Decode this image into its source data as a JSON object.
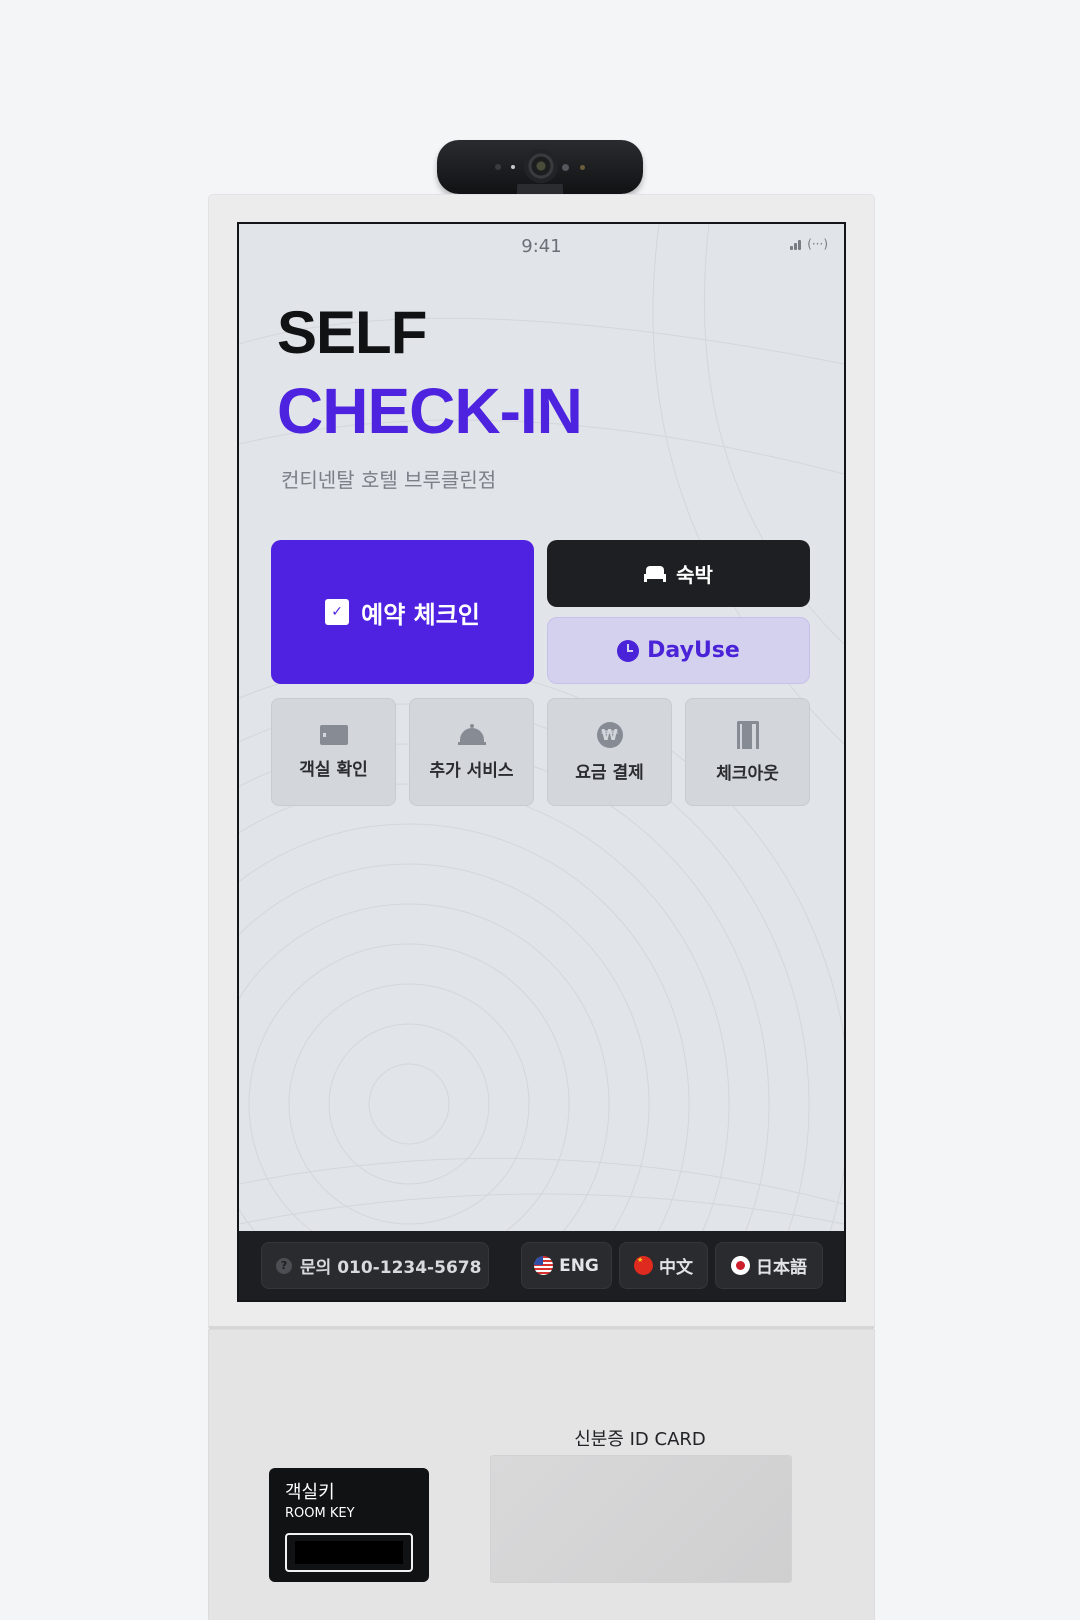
{
  "status_bar": {
    "time": "9:41",
    "signal_icon": "signal-icon",
    "wifi_icon": "wifi-icon"
  },
  "header": {
    "title_line1": "SELF",
    "title_line2": "CHECK-IN",
    "hotel_name": "컨티넨탈 호텔 브루클린점"
  },
  "colors": {
    "accent": "#4f22e2",
    "dark": "#1e1f22",
    "dayuse_bg": "#d4d1ef",
    "screen_bg": "#e1e4e8"
  },
  "main_actions": {
    "reservation_checkin": {
      "label": "예약 체크인",
      "icon": "clipboard-check-icon"
    },
    "stay": {
      "label": "숙박",
      "icon": "bed-icon"
    },
    "dayuse": {
      "label": "DayUse",
      "icon": "clock-icon"
    }
  },
  "sub_actions": [
    {
      "label": "객실 확인",
      "icon": "key-card-icon"
    },
    {
      "label": "추가 서비스",
      "icon": "service-bell-icon"
    },
    {
      "label": "요금 결제",
      "icon": "won-icon"
    },
    {
      "label": "체크아웃",
      "icon": "door-icon"
    }
  ],
  "footer": {
    "contact": "문의 010-1234-5678",
    "languages": [
      {
        "label": "ENG",
        "icon": "us-flag-icon"
      },
      {
        "label": "中文",
        "icon": "china-flag-icon"
      },
      {
        "label": "日本語",
        "icon": "japan-flag-icon"
      }
    ]
  },
  "hardware": {
    "room_key_kor": "객실키",
    "room_key_eng": "ROOM KEY",
    "id_card_label": "신분증 ID CARD"
  }
}
